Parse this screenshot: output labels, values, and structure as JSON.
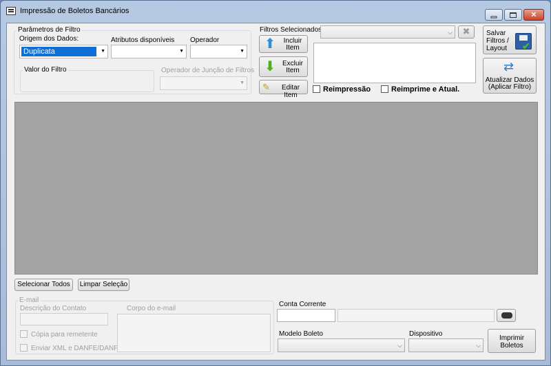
{
  "window": {
    "title": "Impressão de Boletos Bancários"
  },
  "filter_params": {
    "group_label": "Parâmetros de Filtro",
    "origem_label": "Origem dos Dados:",
    "origem_value": "Duplicata",
    "atributos_label": "Atributos disponíveis",
    "operador_label": "Operador",
    "valor_label": "Valor do Filtro",
    "juncao_label": "Operador de Junção de Filtros"
  },
  "selected_filters": {
    "label": "Filtros Selecionados",
    "incluir_label": "Incluir Item",
    "excluir_label": "Excluir Item",
    "editar_label": "Editar Item",
    "reimpressao_label": "Reimpressão",
    "reimprime_label": "Reimprime e Atual."
  },
  "actions": {
    "salvar_label": "Salvar Filtros / Layout",
    "atualizar_label": "Atualizar Dados (Aplicar Filtro)",
    "selecionar_todos": "Selecionar Todos",
    "limpar_selecao": "Limpar Seleção"
  },
  "email": {
    "group_label": "E-mail",
    "descricao_label": "Descrição do Contato",
    "corpo_label": "Corpo do e-mail",
    "copia_label": "Cópia para remetente",
    "enviar_label": "Enviar XML e DANFE/DANFSE"
  },
  "bottom": {
    "conta_label": "Conta Corrente",
    "modelo_label": "Modelo Boleto",
    "dispositivo_label": "Dispositivo",
    "imprimir_label": "Imprimir Boletos"
  },
  "colors": {
    "selection": "#0e6fd6",
    "grid_background": "#a3a3a3",
    "title_bar": "#b6c9e3"
  },
  "icons": {
    "window": "app-window-icon",
    "incluir": "arrow-up-icon",
    "excluir": "arrow-down-icon",
    "editar": "pencil-icon",
    "salvar": "floppy-check-icon",
    "atualizar": "refresh-icon",
    "clear_filter": "clear-x-icon",
    "binoculars": "binoculars-icon"
  }
}
